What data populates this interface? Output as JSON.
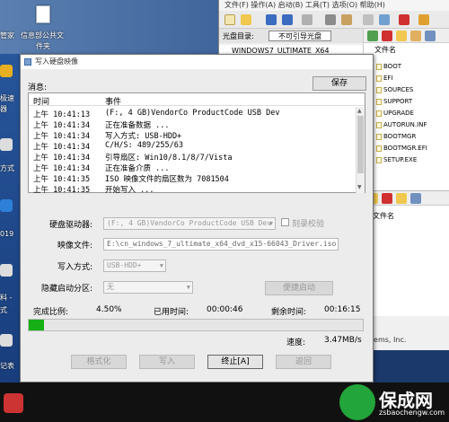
{
  "desktop": {
    "labels": [
      "管家",
      "信息部公共文",
      "件夹",
      "极速",
      "器",
      "方式",
      "019",
      "料 -",
      "式",
      "记表"
    ]
  },
  "bg_app": {
    "menu": "文件(F)  操作(A)  启动(B)  工具(T)  选项(O)  帮助(H)",
    "cd_label": "光盘目录:",
    "cd_value": "不可引导光盘",
    "iso_label": "WINDOWS7_ULTIMATE_X64",
    "file_header": "文件名",
    "files": [
      "BOOT",
      "EFI",
      "SOURCES",
      "SUPPORT",
      "UPGRADE",
      "AUTORUN.INF",
      "BOOTMGR",
      "BOOTMGR.EFI",
      "SETUP.EXE"
    ],
    "file_header_2": "文件名",
    "footer_text": "ystems, Inc."
  },
  "dialog": {
    "title": "写入硬盘映像",
    "messages_label": "消息:",
    "save_label": "保存",
    "col_time": "时间",
    "col_event": "事件",
    "log": [
      {
        "time": "上午 10:41:13",
        "event": "(F:, 4 GB)VendorCo ProductCode USB Dev"
      },
      {
        "time": "上午 10:41:34",
        "event": "正在准备数据 ..."
      },
      {
        "time": "上午 10:41:34",
        "event": "写入方式: USB-HDD+"
      },
      {
        "time": "上午 10:41:34",
        "event": "C/H/S: 489/255/63"
      },
      {
        "time": "上午 10:41:34",
        "event": "引导扇区: Win10/8.1/8/7/Vista"
      },
      {
        "time": "上午 10:41:34",
        "event": "正在准备介质 ..."
      },
      {
        "time": "上午 10:41:35",
        "event": "ISO 映像文件的扇区数为 7081504"
      },
      {
        "time": "上午 10:41:35",
        "event": "开始写入 ..."
      }
    ],
    "drive_label": "硬盘驱动器:",
    "drive_value": "(F:, 4 GB)VendorCo ProductCode USB Dev",
    "verify_label": "刻录校验",
    "image_label": "映像文件:",
    "image_value": "E:\\cn_windows_7_ultimate_x64_dvd_x15-66043_Driver.iso",
    "mode_label": "写入方式:",
    "mode_value": "USB-HDD+",
    "hidden_label": "隐藏启动分区:",
    "hidden_value": "无",
    "browse_label": "便捷启动",
    "done_label": "完成比例:",
    "done_value": "4.50%",
    "progress_fraction": 0.045,
    "elapsed_label": "已用时间:",
    "elapsed_value": "00:00:46",
    "remaining_label": "剩余时间:",
    "remaining_value": "00:16:15",
    "speed_label": "速度:",
    "speed_value": "3.47MB/s",
    "btn_format": "格式化",
    "btn_write": "写入",
    "btn_stop": "终止[A]",
    "btn_back": "返回"
  },
  "watermark": {
    "brand": "保成网",
    "url": "zsbaochengw.com"
  }
}
